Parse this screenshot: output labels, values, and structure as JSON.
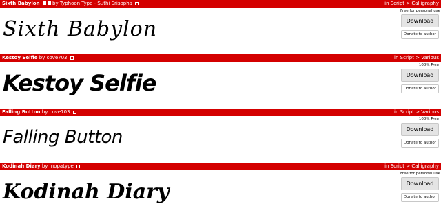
{
  "fonts": [
    {
      "name": "Sixth Babylon",
      "by": "by",
      "author": "Typhoon Type - Suthi Srisopha",
      "category": "in Script > Calligraphy",
      "license": "Free for personal use",
      "preview": "Sixth Babylon",
      "download_label": "Download",
      "donate_label": "Donate to author"
    },
    {
      "name": "Kestoy Selfie",
      "by": "by",
      "author": "cove703",
      "category": "in Script > Various",
      "license": "100% Free",
      "preview": "Kestoy Selfie",
      "download_label": "Download",
      "donate_label": "Donate to author"
    },
    {
      "name": "Falling Button",
      "by": "by",
      "author": "cove703",
      "category": "in Script > Various",
      "license": "100% Free",
      "preview": "Falling Button",
      "download_label": "Download",
      "donate_label": "Donate to author"
    },
    {
      "name": "Kodinah Diary",
      "by": "by",
      "author": "Inopatype",
      "category": "in Script > Calligraphy",
      "license": "Free for personal use",
      "preview": "Kodinah Diary",
      "download_label": "Download",
      "donate_label": "Donate to author"
    }
  ],
  "colors": {
    "bar": "#d40000",
    "button": "#e4e4e4"
  },
  "icons": [
    "external-link-icon",
    "file-icon"
  ]
}
